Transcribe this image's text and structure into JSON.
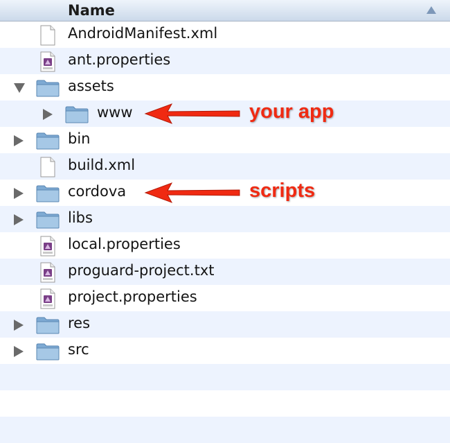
{
  "header": {
    "name_label": "Name"
  },
  "rows": [
    {
      "label": "AndroidManifest.xml",
      "kind": "file-icon",
      "depth": 0,
      "disclosure": "none"
    },
    {
      "label": "ant.properties",
      "kind": "java-file-icon",
      "depth": 0,
      "disclosure": "none"
    },
    {
      "label": "assets",
      "kind": "folder-icon",
      "depth": 0,
      "disclosure": "expanded"
    },
    {
      "label": "www",
      "kind": "folder-icon",
      "depth": 1,
      "disclosure": "collapsed"
    },
    {
      "label": "bin",
      "kind": "folder-icon",
      "depth": 0,
      "disclosure": "collapsed"
    },
    {
      "label": "build.xml",
      "kind": "file-icon",
      "depth": 0,
      "disclosure": "none"
    },
    {
      "label": "cordova",
      "kind": "folder-icon",
      "depth": 0,
      "disclosure": "collapsed"
    },
    {
      "label": "libs",
      "kind": "folder-icon",
      "depth": 0,
      "disclosure": "collapsed"
    },
    {
      "label": "local.properties",
      "kind": "java-file-icon",
      "depth": 0,
      "disclosure": "none"
    },
    {
      "label": "proguard-project.txt",
      "kind": "text-file-icon",
      "depth": 0,
      "disclosure": "none"
    },
    {
      "label": "project.properties",
      "kind": "java-file-icon",
      "depth": 0,
      "disclosure": "none"
    },
    {
      "label": "res",
      "kind": "folder-icon",
      "depth": 0,
      "disclosure": "collapsed"
    },
    {
      "label": "src",
      "kind": "folder-icon",
      "depth": 0,
      "disclosure": "collapsed"
    },
    {
      "label": "",
      "kind": "",
      "depth": 0,
      "disclosure": "none"
    },
    {
      "label": "",
      "kind": "",
      "depth": 0,
      "disclosure": "none"
    },
    {
      "label": "",
      "kind": "",
      "depth": 0,
      "disclosure": "none"
    }
  ],
  "annotations": [
    {
      "text": "your app",
      "row": 3
    },
    {
      "text": "scripts",
      "row": 6
    }
  ],
  "colors": {
    "annotation": "#f02a12",
    "alt_row": "#edf3fe",
    "folder": "#8fb8dc"
  }
}
